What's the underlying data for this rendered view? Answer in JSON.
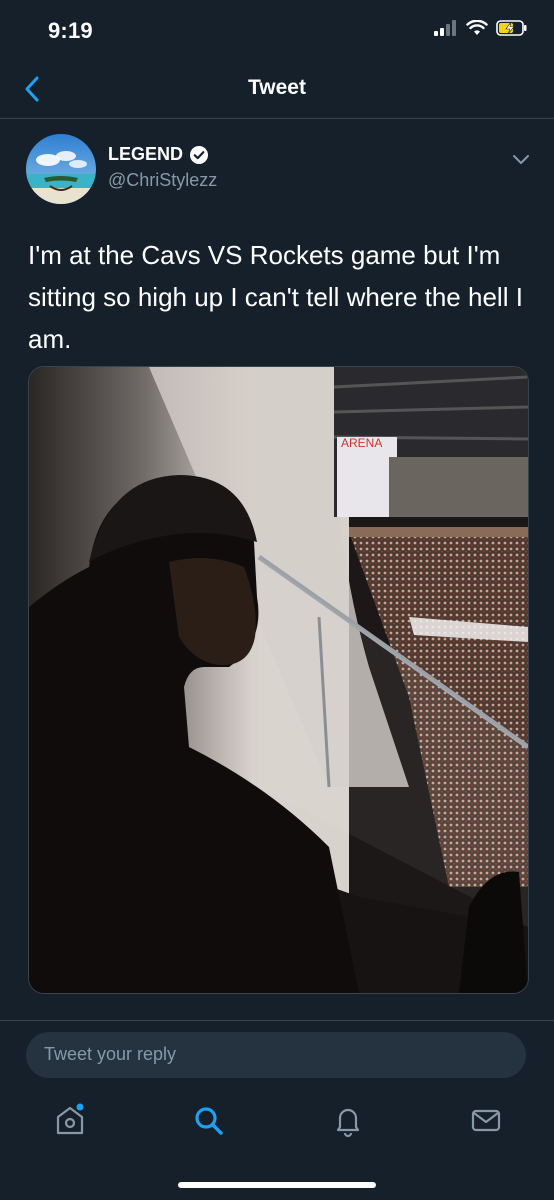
{
  "status_bar": {
    "time": "9:19"
  },
  "nav": {
    "title": "Tweet"
  },
  "tweet": {
    "display_name": "LEGEND",
    "handle": "@ChriStylezz",
    "verified": true,
    "text": "I'm at the Cavs VS Rockets game but I'm sitting so high up I can't tell where the hell I am."
  },
  "reply": {
    "placeholder": "Tweet your reply"
  },
  "tab_bar": {
    "items": [
      "home-icon",
      "search-icon",
      "notifications-icon",
      "messages-icon"
    ],
    "active": "search-icon"
  },
  "colors": {
    "background": "#15202b",
    "accent": "#1da1f2",
    "secondary_text": "#8899a6",
    "border": "#38444d",
    "battery": "#f5d60e"
  }
}
